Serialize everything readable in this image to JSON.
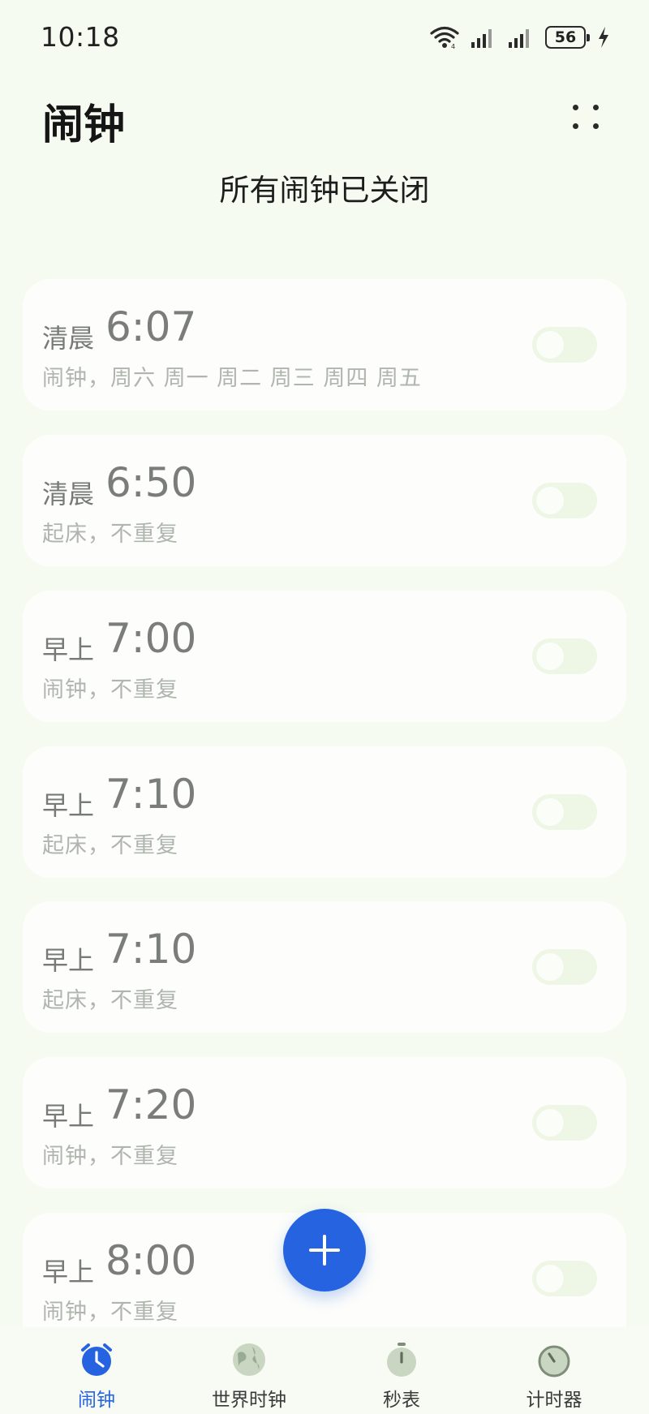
{
  "status_bar": {
    "time": "10:18",
    "battery": "56",
    "icons": [
      "wifi-icon",
      "signal-1-icon",
      "signal-2-icon",
      "battery-icon",
      "charging-icon"
    ]
  },
  "header": {
    "title": "闹钟",
    "menu_icon": "more-dots-icon"
  },
  "subtitle": "所有闹钟已关闭",
  "alarms": [
    {
      "period": "清晨",
      "time": "6:07",
      "desc": "闹钟，周六 周一 周二 周三 周四 周五",
      "enabled": false
    },
    {
      "period": "清晨",
      "time": "6:50",
      "desc": "起床，不重复",
      "enabled": false
    },
    {
      "period": "早上",
      "time": "7:00",
      "desc": "闹钟，不重复",
      "enabled": false
    },
    {
      "period": "早上",
      "time": "7:10",
      "desc": "起床，不重复",
      "enabled": false
    },
    {
      "period": "早上",
      "time": "7:10",
      "desc": "起床，不重复",
      "enabled": false
    },
    {
      "period": "早上",
      "time": "7:20",
      "desc": "闹钟，不重复",
      "enabled": false
    },
    {
      "period": "早上",
      "time": "8:00",
      "desc": "闹钟，不重复",
      "enabled": false
    }
  ],
  "fab": {
    "icon": "plus-icon"
  },
  "bottom_nav": [
    {
      "label": "闹钟",
      "icon": "alarm-clock-icon",
      "active": true
    },
    {
      "label": "世界时钟",
      "icon": "globe-icon",
      "active": false
    },
    {
      "label": "秒表",
      "icon": "stopwatch-icon",
      "active": false
    },
    {
      "label": "计时器",
      "icon": "timer-icon",
      "active": false
    }
  ],
  "colors": {
    "background": "#f6fbf1",
    "accent": "#2563e0",
    "card": "#fdfefb",
    "toggle_off": "#eef6e6",
    "inactive_icon": "#c9d6c2"
  }
}
